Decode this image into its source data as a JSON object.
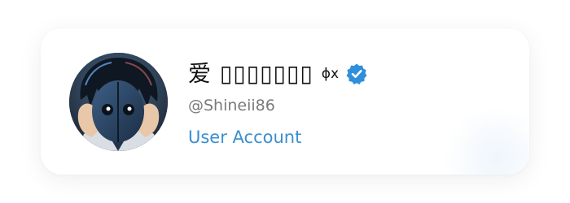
{
  "profile": {
    "display_name": "爱 ▯▯▯▯▯▯▯",
    "name_suffix": "ɸx",
    "handle": "@Shineii86",
    "account_type": "User Account",
    "verified": true,
    "verified_icon": "verified-badge-icon",
    "avatar_icon": "anime-avatar"
  },
  "colors": {
    "link": "#3a8fd1",
    "verified": "#2f8fdb",
    "handle": "#7a7a7a",
    "name": "#111111"
  }
}
